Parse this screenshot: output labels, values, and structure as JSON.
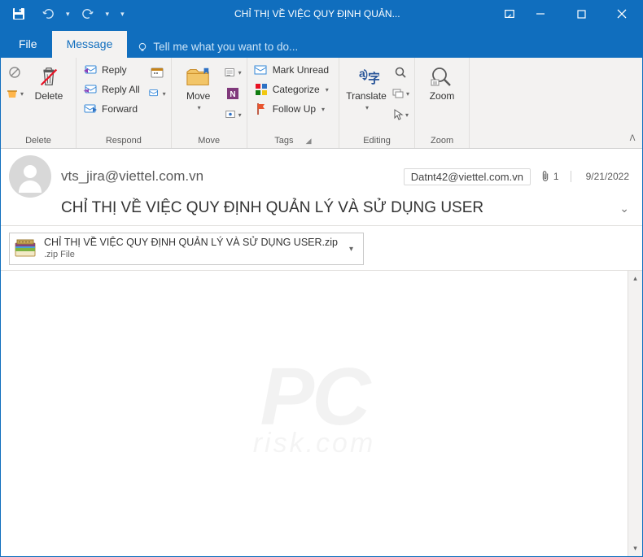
{
  "titlebar": {
    "title": "CHỈ THỊ VỀ VIỆC QUY ĐỊNH QUẢN..."
  },
  "tabs": {
    "file": "File",
    "message": "Message",
    "tell_me": "Tell me what you want to do..."
  },
  "ribbon": {
    "delete": {
      "junk_dd": "▾",
      "delete": "Delete",
      "group": "Delete"
    },
    "respond": {
      "reply": "Reply",
      "reply_all": "Reply All",
      "forward": "Forward",
      "group": "Respond"
    },
    "move": {
      "move": "Move",
      "group": "Move"
    },
    "tags": {
      "mark_unread": "Mark Unread",
      "categorize": "Categorize",
      "follow_up": "Follow Up",
      "group": "Tags"
    },
    "editing": {
      "translate": "Translate",
      "group": "Editing"
    },
    "zoom": {
      "zoom": "Zoom",
      "group": "Zoom"
    }
  },
  "header": {
    "from": "vts_jira@viettel.com.vn",
    "to": "Datnt42@viettel.com.vn",
    "attachments_count": "1",
    "date": "9/21/2022",
    "subject": "CHỈ THỊ VỀ VIỆC QUY ĐỊNH QUẢN LÝ VÀ SỬ DỤNG USER"
  },
  "attachment": {
    "name": "CHỈ THỊ VỀ VIỆC QUY ĐỊNH QUẢN LÝ VÀ SỬ DỤNG USER.zip",
    "type": ".zip File"
  },
  "watermark": {
    "line1": "PC",
    "line2": "risk.com"
  }
}
